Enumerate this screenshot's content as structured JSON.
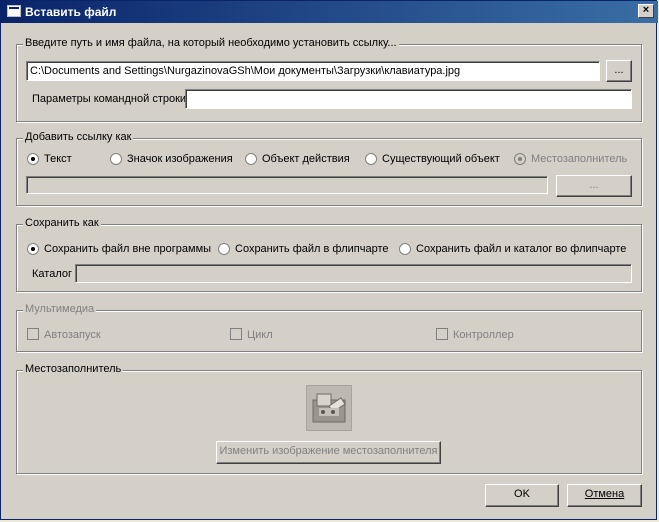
{
  "window": {
    "title": "Вставить файл",
    "close": "×"
  },
  "path_group": {
    "legend": "Введите путь и имя файла, на который необходимо установить ссылку...",
    "path_value": "C:\\Documents and Settings\\NurgazinovaGSh\\Мои документы\\Загрузки\\клавиатура.jpg",
    "browse_label": "...",
    "cmdline_label": "Параметры командной строки",
    "cmdline_value": ""
  },
  "link_group": {
    "legend": "Добавить ссылку как",
    "options": [
      "Текст",
      "Значок изображения",
      "Объект действия",
      "Существующий объект",
      "Местозаполнитель"
    ],
    "selected": "Текст",
    "browse_label": "..."
  },
  "save_group": {
    "legend": "Сохранить как",
    "options": [
      "Сохранить файл вне программы",
      "Сохранить файл в флипчарте",
      "Сохранить файл и каталог во флипчарте"
    ],
    "selected": "Сохранить файл вне программы",
    "catalog_label": "Каталог",
    "catalog_value": ""
  },
  "media_group": {
    "legend": "Мультимедиа",
    "options": [
      "Автозапуск",
      "Цикл",
      "Контроллер"
    ]
  },
  "placeholder_group": {
    "legend": "Местозаполнитель",
    "icon": "placeholder-image-icon",
    "change_label": "Изменить изображение местозаполнителя"
  },
  "buttons": {
    "ok": "OK",
    "cancel": "Отмена"
  }
}
